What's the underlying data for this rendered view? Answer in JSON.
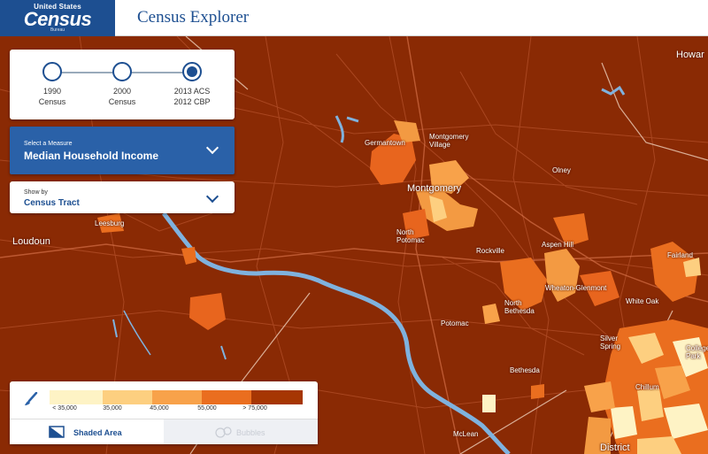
{
  "header": {
    "logo_line1": "United States",
    "logo_line2": "Census",
    "logo_line3": "Bureau",
    "app_title": "Census Explorer"
  },
  "timeline": {
    "items": [
      {
        "line1": "1990",
        "line2": "Census",
        "active": false
      },
      {
        "line1": "2000",
        "line2": "Census",
        "active": false
      },
      {
        "line1": "2013 ACS",
        "line2": "2012 CBP",
        "active": true
      }
    ]
  },
  "measure": {
    "caption": "Select a Measure",
    "value": "Median Household Income"
  },
  "show_by": {
    "caption": "Show by",
    "value": "Census Tract"
  },
  "legend": {
    "swatch_colors": [
      "#fef3c5",
      "#fdcf80",
      "#f8a24a",
      "#ea6e1f",
      "#a63603"
    ],
    "ticks": [
      "< 35,000",
      "35,000",
      "45,000",
      "55,000",
      "> 75,000"
    ],
    "tabs": {
      "shaded": "Shaded Area",
      "bubbles": "Bubbles"
    }
  },
  "map": {
    "places": [
      {
        "name": "Germantown",
        "size": "small"
      },
      {
        "name": "Montgomery Village",
        "size": "small"
      },
      {
        "name": "Montgomery",
        "size": "big"
      },
      {
        "name": "Olney",
        "size": "small"
      },
      {
        "name": "Leesburg",
        "size": "small"
      },
      {
        "name": "Loudoun",
        "size": "big"
      },
      {
        "name": "North Potomac",
        "size": "small"
      },
      {
        "name": "Rockville",
        "size": "small"
      },
      {
        "name": "Aspen Hill",
        "size": "small"
      },
      {
        "name": "Fairland",
        "size": "small"
      },
      {
        "name": "Wheaton-Glenmont",
        "size": "small"
      },
      {
        "name": "North Bethesda",
        "size": "small"
      },
      {
        "name": "White Oak",
        "size": "small"
      },
      {
        "name": "Potomac",
        "size": "small"
      },
      {
        "name": "Silver Spring",
        "size": "small"
      },
      {
        "name": "Bethesda",
        "size": "small"
      },
      {
        "name": "Chillum",
        "size": "small"
      },
      {
        "name": "College Park",
        "size": "small"
      },
      {
        "name": "McLean",
        "size": "small"
      },
      {
        "name": "District",
        "size": "big"
      },
      {
        "name": "Howar",
        "size": "big"
      }
    ]
  }
}
